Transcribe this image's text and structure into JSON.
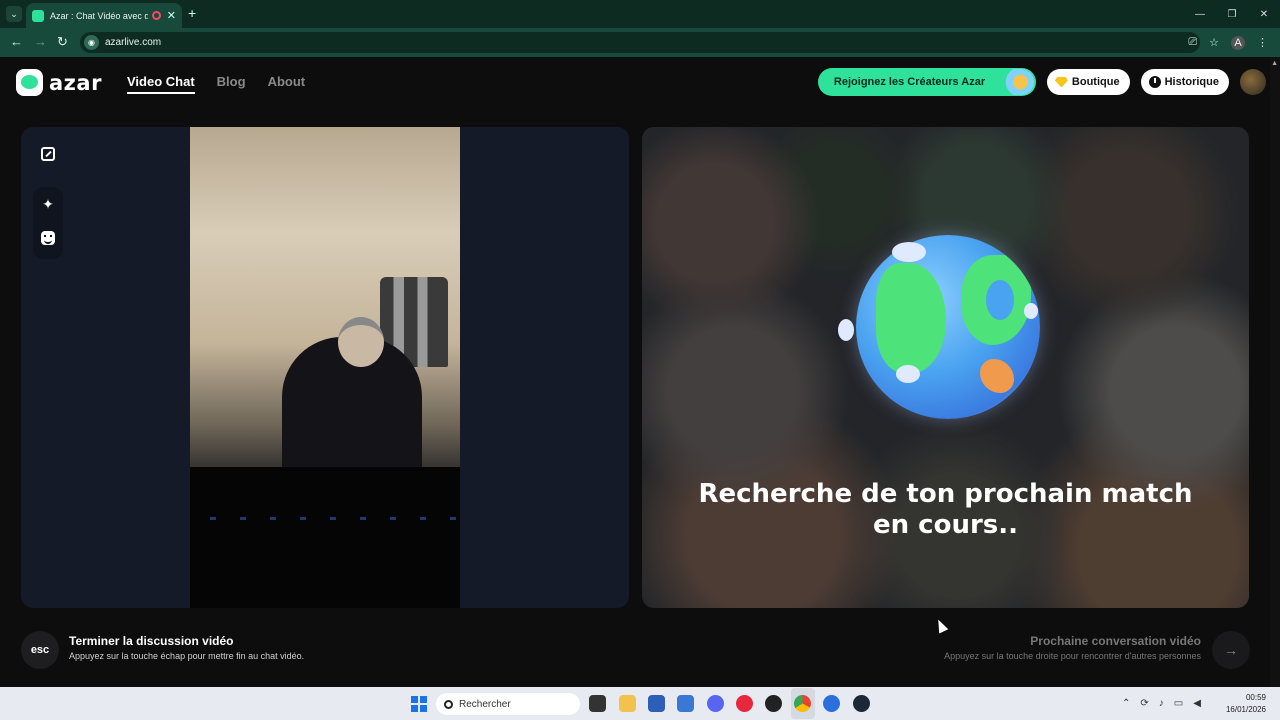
{
  "browser": {
    "tab_title": "Azar : Chat Vidéo avec de n",
    "url": "azarlive.com",
    "profile_initial": "A"
  },
  "header": {
    "logo_text": "azar",
    "nav": [
      {
        "label": "Video Chat",
        "active": true
      },
      {
        "label": "Blog",
        "active": false
      },
      {
        "label": "About",
        "active": false
      }
    ],
    "creators_label": "Rejoignez les Créateurs Azar",
    "shop_label": "Boutique",
    "history_label": "Historique"
  },
  "match": {
    "status_text": "Recherche de ton prochain match en cours.."
  },
  "footer": {
    "esc_key": "esc",
    "end_title": "Terminer la discussion vidéo",
    "end_subtitle": "Appuyez sur la touche échap pour mettre fin au chat vidéo.",
    "next_title": "Prochaine conversation vidéo",
    "next_subtitle": "Appuyez sur la touche droite pour rencontrer d'autres personnes"
  },
  "taskbar": {
    "search_placeholder": "Rechercher",
    "time": "00:59",
    "date": "16/01/2026"
  },
  "colors": {
    "accent": "#2ee29b",
    "page_bg": "#0d0d0d",
    "chrome_bg": "#174a3a"
  }
}
